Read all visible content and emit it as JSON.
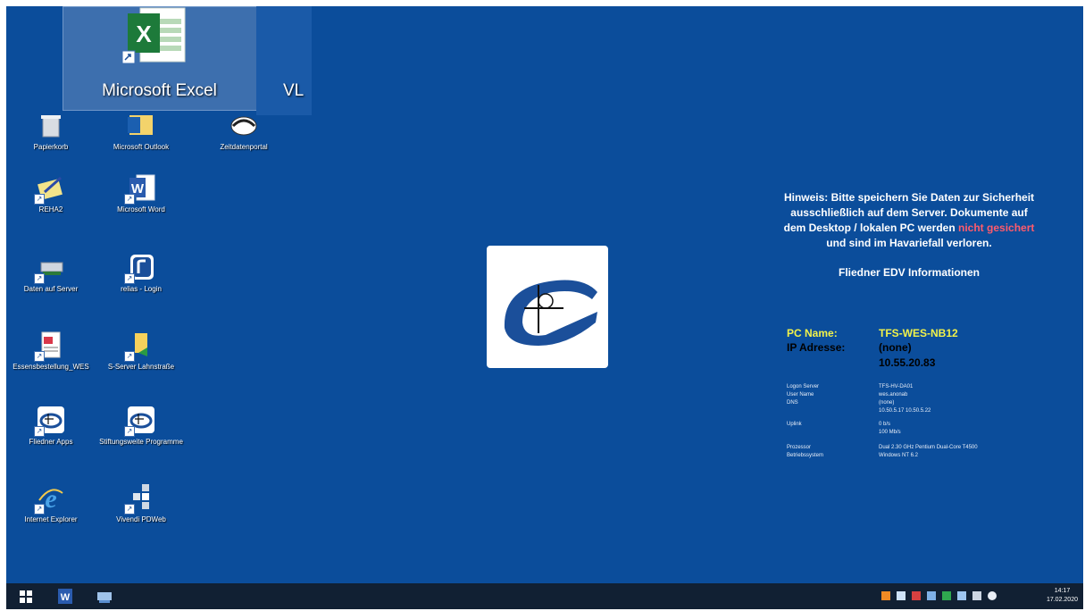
{
  "tooltip": {
    "label": "Microsoft Excel",
    "side_label": "VL"
  },
  "desktop_icons": [
    {
      "name": "papierkorb",
      "label": "Papierkorb"
    },
    {
      "name": "microsoft-outlook",
      "label": "Microsoft Outlook"
    },
    {
      "name": "zeitdatenportal",
      "label": "Zeitdatenportal"
    },
    {
      "name": "reha2",
      "label": "REHA2"
    },
    {
      "name": "microsoft-word",
      "label": "Microsoft Word"
    },
    {
      "name": "daten-auf-server",
      "label": "Daten auf Server"
    },
    {
      "name": "relias-login",
      "label": "relias - Login"
    },
    {
      "name": "essensbestellung",
      "label": "Essensbestellung_WES"
    },
    {
      "name": "s-server",
      "label": "S-Server Lahnstraße"
    },
    {
      "name": "fliedner-apps",
      "label": "Fliedner Apps"
    },
    {
      "name": "stiftungsweite",
      "label": "Stiftungsweite Programme"
    },
    {
      "name": "internet-explorer",
      "label": "Internet Explorer"
    },
    {
      "name": "vivendi-pdweb",
      "label": "Vivendi PDWeb"
    }
  ],
  "info": {
    "notice_part1": "Hinweis:  Bitte speichern Sie Daten zur Sicherheit ausschließlich auf dem Server. Dokumente auf dem Desktop / lokalen PC werden",
    "notice_warn": "nicht gesichert",
    "notice_part2": "und sind im Havariefall verloren.",
    "title": "Fliedner EDV Informationen",
    "pc_name_label": "PC Name:",
    "pc_name_value": "TFS-WES-NB12",
    "ip_label": "IP Adresse:",
    "ip_value1": "(none)",
    "ip_value2": "10.55.20.83",
    "details": [
      {
        "label": "Logon Server",
        "value": "TFS-HV-DA01"
      },
      {
        "label": "User Name",
        "value": "wes.anonab"
      },
      {
        "label": "DNS",
        "value": "(none)"
      },
      {
        "label": "",
        "value": "10.50.5.17 10.50.5.22"
      },
      {
        "label": "Uplink",
        "value": "0 b/s"
      },
      {
        "label": "",
        "value": "100 Mb/s"
      },
      {
        "label": "Prozessor",
        "value": "Dual 2.30 GHz Pentium Dual-Core    T4500"
      },
      {
        "label": "Betriebssystem",
        "value": "Windows NT 6.2"
      }
    ],
    "colors": {
      "name_yellow": "#f2f24a",
      "warn_red": "#ff5b6c"
    }
  },
  "taskbar": {
    "time": "14:17",
    "date": "17.02.2020",
    "buttons": [
      "start-icon",
      "word-icon",
      "network-drive-icon"
    ]
  }
}
